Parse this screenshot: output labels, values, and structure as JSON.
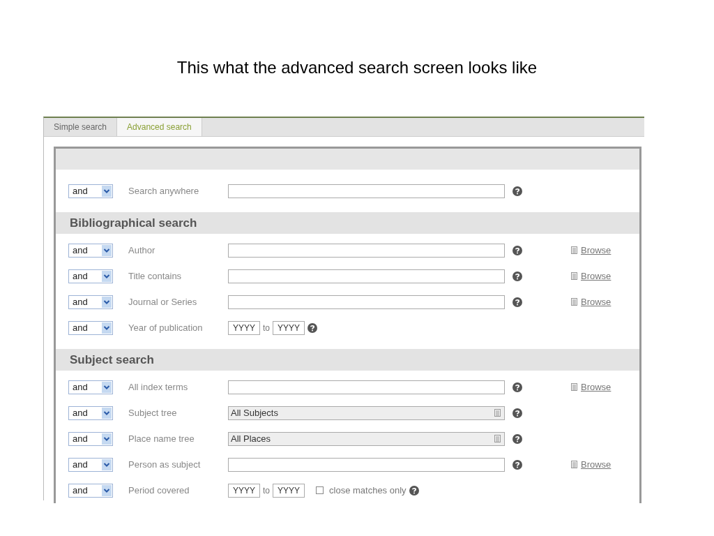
{
  "slide_title": "This what the advanced search screen looks like",
  "tabs": [
    {
      "label": "Simple search",
      "selected": false
    },
    {
      "label": "Advanced search",
      "selected": true
    }
  ],
  "sections": [
    {
      "rows": [
        {
          "kind": "text",
          "operator": "and",
          "label": "Search anywhere"
        }
      ]
    },
    {
      "heading": "Bibliographical search",
      "rows": [
        {
          "kind": "text",
          "operator": "and",
          "label": "Author",
          "browse": "Browse"
        },
        {
          "kind": "text",
          "operator": "and",
          "label": "Title contains",
          "browse": "Browse"
        },
        {
          "kind": "text",
          "operator": "and",
          "label": "Journal or Series",
          "browse": "Browse"
        },
        {
          "kind": "years",
          "operator": "and",
          "label": "Year of publication",
          "from_placeholder": "YYYY",
          "to": "to",
          "to_placeholder": "YYYY"
        }
      ]
    },
    {
      "heading": "Subject search",
      "rows": [
        {
          "kind": "text",
          "operator": "and",
          "label": "All index terms",
          "browse": "Browse"
        },
        {
          "kind": "tree",
          "operator": "and",
          "label": "Subject tree",
          "value": "All Subjects"
        },
        {
          "kind": "tree",
          "operator": "and",
          "label": "Place name tree",
          "value": "All Places"
        },
        {
          "kind": "text",
          "operator": "and",
          "label": "Person as subject",
          "browse": "Browse"
        },
        {
          "kind": "years",
          "operator": "and",
          "label": "Period covered",
          "from_placeholder": "YYYY",
          "to": "to",
          "to_placeholder": "YYYY",
          "checkbox": {
            "label": "close matches only",
            "checked": false
          }
        }
      ]
    }
  ]
}
